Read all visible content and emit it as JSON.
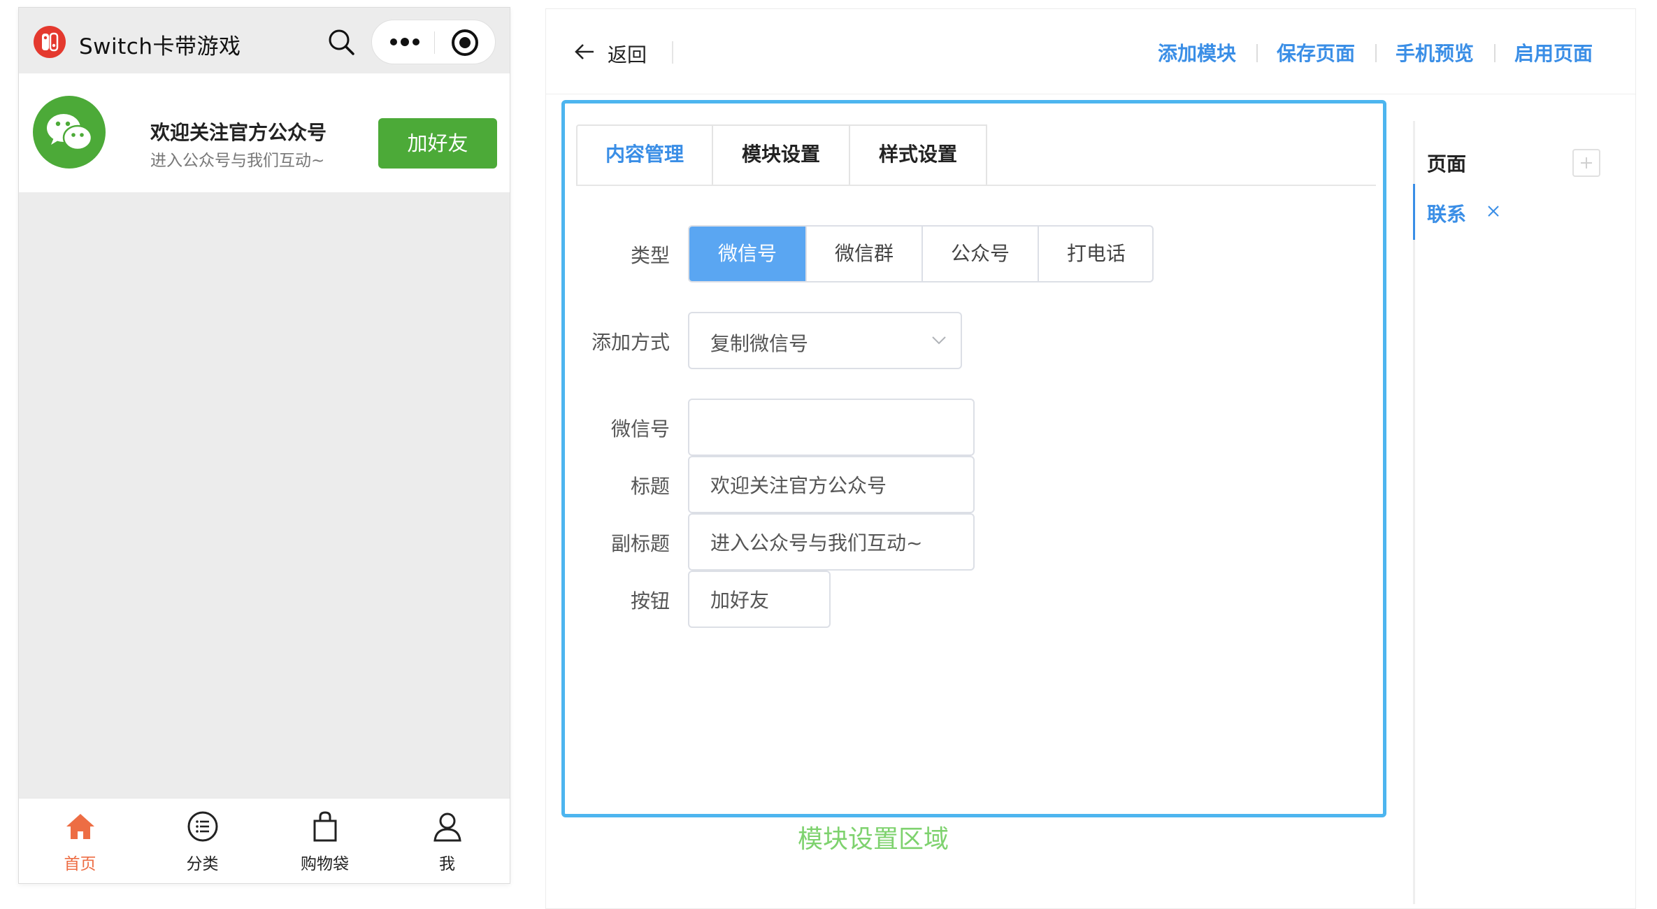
{
  "phone": {
    "app_title": "Switch卡带游戏",
    "follow_card": {
      "title": "欢迎关注官方公众号",
      "subtitle": "进入公众号与我们互动~",
      "button": "加好友"
    },
    "tabbar": [
      {
        "label": "首页",
        "icon": "home-icon",
        "active": true
      },
      {
        "label": "分类",
        "icon": "list-icon",
        "active": false
      },
      {
        "label": "购物袋",
        "icon": "bag-icon",
        "active": false
      },
      {
        "label": "我",
        "icon": "user-icon",
        "active": false
      }
    ]
  },
  "topbar": {
    "back_label": "返回",
    "actions": [
      "添加模块",
      "保存页面",
      "手机预览",
      "启用页面"
    ]
  },
  "module": {
    "tabs": [
      "内容管理",
      "模块设置",
      "样式设置"
    ],
    "active_tab": "内容管理",
    "type_label": "类型",
    "type_options": [
      "微信号",
      "微信群",
      "公众号",
      "打电话"
    ],
    "type_selected": "微信号",
    "add_method_label": "添加方式",
    "add_method_value": "复制微信号",
    "wechat_id_label": "微信号",
    "wechat_id_value": "",
    "title_label": "标题",
    "title_value": "欢迎关注官方公众号",
    "subtitle_label": "副标题",
    "subtitle_value": "进入公众号与我们互动~",
    "button_label": "按钮",
    "button_value": "加好友",
    "area_caption": "模块设置区域"
  },
  "page_panel": {
    "title": "页面",
    "pages": [
      "联系"
    ]
  },
  "colors": {
    "accent": "#3a8ee6",
    "wechat_green": "#4caa38",
    "active_tab_orange": "#ed6d44",
    "module_border": "#4db5ef",
    "caption_green": "#7ed26e"
  }
}
